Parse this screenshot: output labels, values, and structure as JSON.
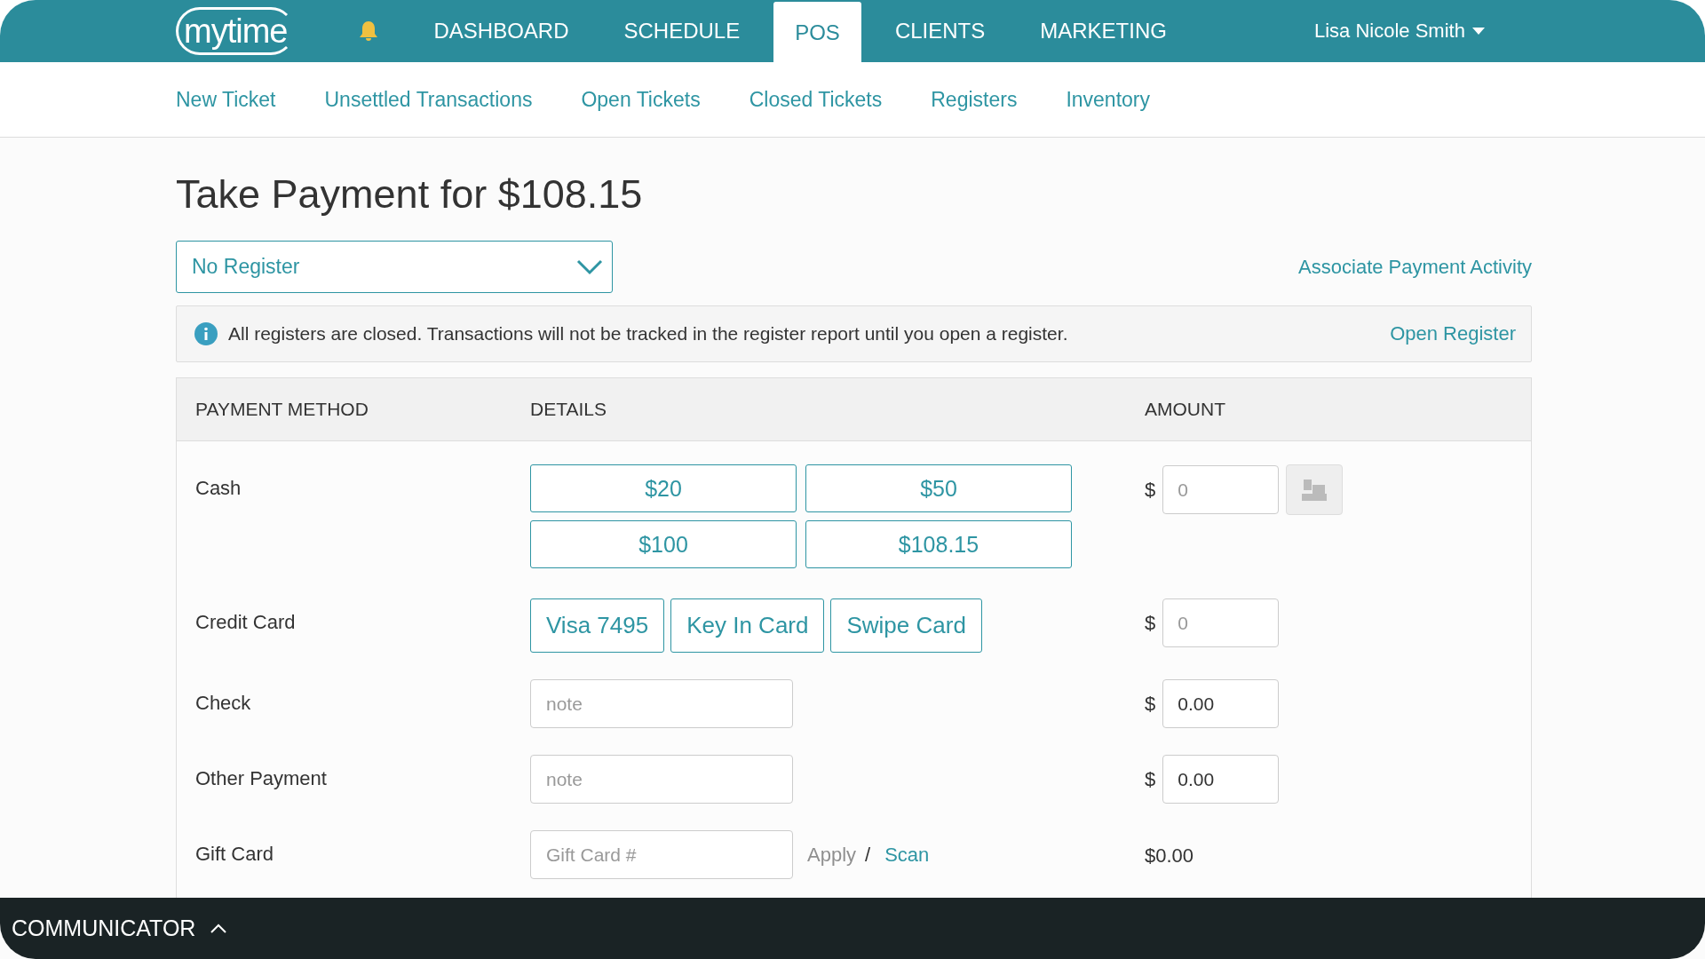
{
  "top_nav": {
    "logo": "mytime",
    "tabs": [
      {
        "label": "DASHBOARD",
        "selected": false
      },
      {
        "label": "SCHEDULE",
        "selected": false
      },
      {
        "label": "POS",
        "selected": true
      },
      {
        "label": "CLIENTS",
        "selected": false
      },
      {
        "label": "MARKETING",
        "selected": false
      }
    ],
    "user": "Lisa Nicole Smith"
  },
  "sub_nav": [
    "New Ticket",
    "Unsettled Transactions",
    "Open Tickets",
    "Closed Tickets",
    "Registers",
    "Inventory"
  ],
  "title": "Take Payment for $108.15",
  "register_select": {
    "value": "No Register"
  },
  "associate_link": "Associate Payment Activity",
  "notice": {
    "message": "All registers are closed. Transactions will not be tracked in the register report until you open a register.",
    "link": "Open Register"
  },
  "table": {
    "columns": [
      "PAYMENT METHOD",
      "DETAILS",
      "AMOUNT"
    ],
    "rows": [
      {
        "kind": "cash",
        "method": "Cash",
        "buttons": [
          "$20",
          "$50",
          "$100",
          "$108.15"
        ],
        "currency": "$",
        "amount_placeholder": "0"
      },
      {
        "kind": "card",
        "method": "Credit Card",
        "buttons": [
          "Visa 7495",
          "Key In Card",
          "Swipe Card"
        ],
        "currency": "$",
        "amount_placeholder": "0"
      },
      {
        "kind": "note",
        "method": "Check",
        "placeholder": "note",
        "currency": "$",
        "amount": "0.00"
      },
      {
        "kind": "note",
        "method": "Other Payment",
        "placeholder": "note",
        "currency": "$",
        "amount": "0.00"
      },
      {
        "kind": "gift",
        "method": "Gift Card",
        "placeholder": "Gift Card #",
        "apply": {
          "label": "Apply",
          "disabled": true
        },
        "separator": "/",
        "scan": "Scan",
        "amount_text": "$0.00"
      }
    ]
  },
  "communicator": {
    "label": "COMMUNICATOR"
  }
}
